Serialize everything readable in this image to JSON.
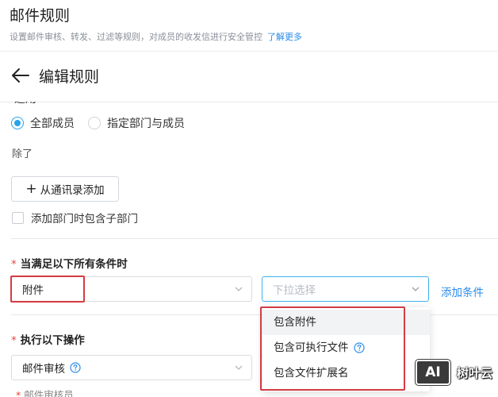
{
  "page": {
    "title": "邮件规则",
    "description": "设置邮件审核、转发、过滤等规则，对成员的收发信进行安全管控",
    "learn_more": "了解更多"
  },
  "edit": {
    "title": "编辑规则",
    "clipped_label": "适用"
  },
  "members": {
    "options": [
      {
        "label": "全部成员",
        "checked": true
      },
      {
        "label": "指定部门与成员",
        "checked": false
      }
    ],
    "except_label": "除了",
    "add_from_contacts": "从通讯录添加",
    "include_sub_dept": "添加部门时包含子部门"
  },
  "conditions": {
    "required_mark": "*",
    "title": "当满足以下所有条件时",
    "field_value": "附件",
    "operator_placeholder": "下拉选择",
    "add_condition": "添加条件",
    "menu": [
      {
        "label": "包含附件",
        "help": false,
        "hovered": true
      },
      {
        "label": "包含可执行文件",
        "help": true,
        "hovered": false
      },
      {
        "label": "包含文件扩展名",
        "help": false,
        "hovered": false
      }
    ]
  },
  "actions": {
    "required_mark": "*",
    "title": "执行以下操作",
    "action_value": "邮件审核",
    "sub_label": "邮件审核员"
  },
  "watermark": {
    "logo": "AI",
    "text": "树叶云"
  },
  "colors": {
    "accent": "#26a3ea",
    "link": "#2a8bea",
    "required": "#e8453c",
    "annotation": "#d43c44"
  }
}
